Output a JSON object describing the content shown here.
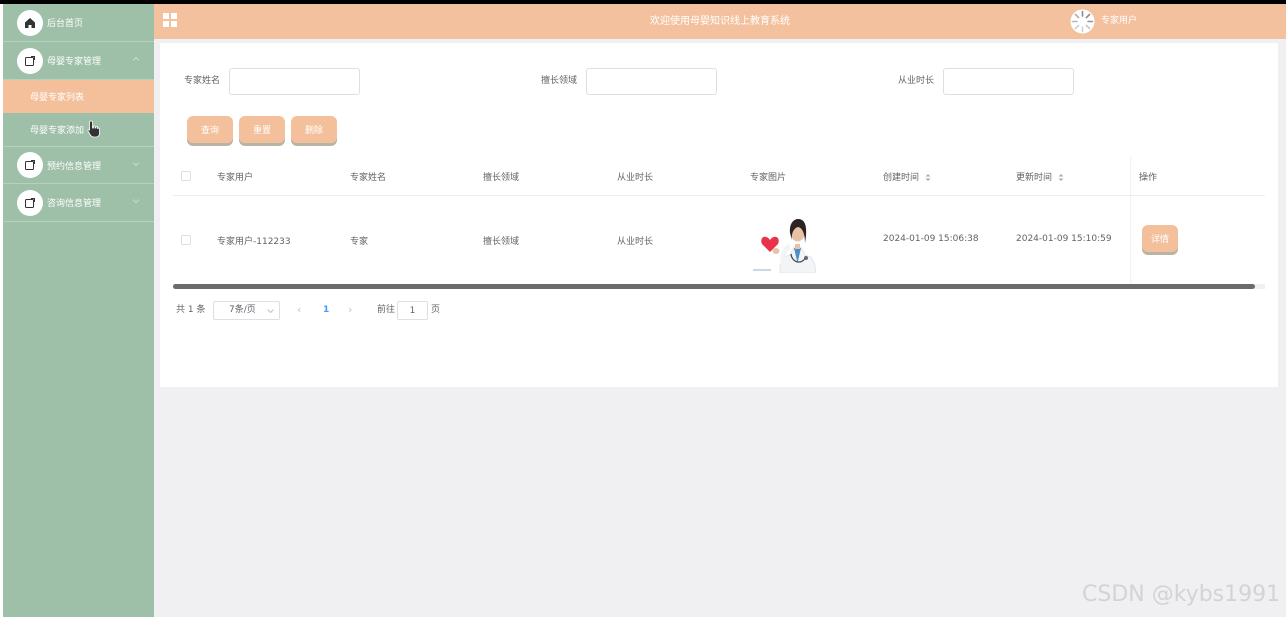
{
  "header": {
    "welcome": "欢迎使用母婴知识线上教育系统",
    "user_name": "专家用户"
  },
  "sidebar": {
    "items": [
      {
        "label": "后台首页",
        "icon": "home-icon"
      },
      {
        "label": "母婴专家管理",
        "icon": "edit-icon",
        "expanded": true
      },
      {
        "label": "预约信息管理",
        "icon": "edit-icon"
      },
      {
        "label": "咨询信息管理",
        "icon": "edit-icon"
      }
    ],
    "sub_items": [
      {
        "label": "母婴专家列表",
        "active": true
      },
      {
        "label": "母婴专家添加",
        "active": false
      }
    ]
  },
  "search": {
    "fields": [
      {
        "label": "专家姓名",
        "value": ""
      },
      {
        "label": "擅长领域",
        "value": ""
      },
      {
        "label": "从业时长",
        "value": ""
      }
    ],
    "buttons": {
      "query": "查询",
      "reset": "重置",
      "delete": "删除"
    }
  },
  "table": {
    "columns": [
      "专家用户",
      "专家姓名",
      "擅长领域",
      "从业时长",
      "专家图片",
      "创建时间",
      "更新时间",
      "操作"
    ],
    "rows": [
      {
        "user": "专家用户-112233",
        "name": "专家",
        "field": "擅长领域",
        "duration": "从业时长",
        "image": "doctor-photo",
        "created": "2024-01-09 15:06:38",
        "updated": "2024-01-09 15:10:59",
        "action": "详情"
      }
    ]
  },
  "pagination": {
    "total_text": "共 1 条",
    "page_size": "7条/页",
    "current_page": "1",
    "goto_label": "前往",
    "goto_value": "1",
    "page_suffix": "页"
  },
  "watermark": "CSDN @kybs1991",
  "colors": {
    "sidebar_bg": "#9ebfa8",
    "header_bg": "#f4c19f",
    "accent": "#f4c09c",
    "content_bg": "#f0f0f2"
  }
}
